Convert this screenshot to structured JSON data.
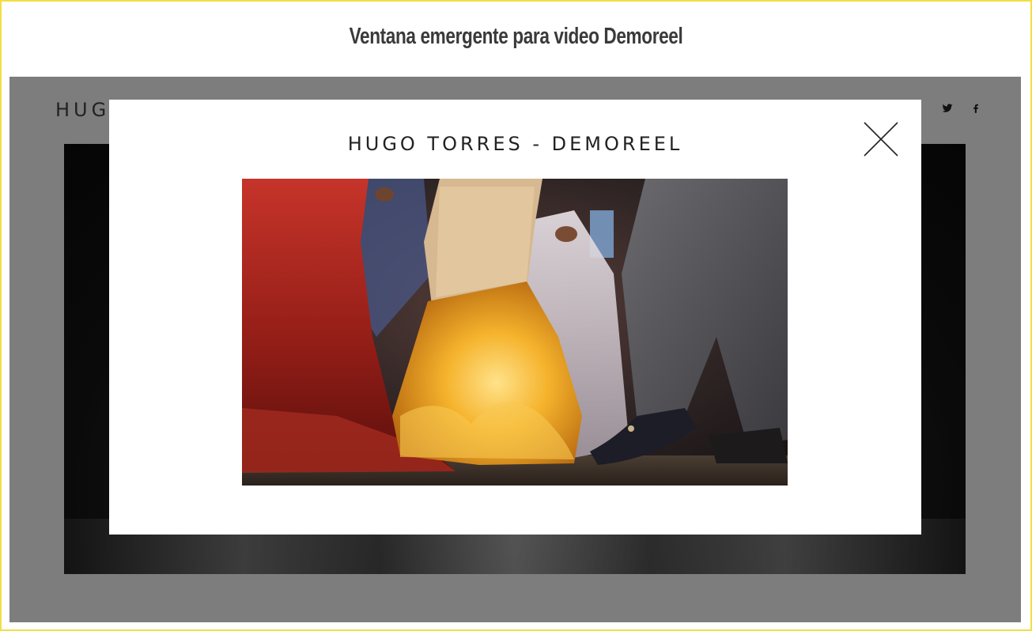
{
  "caption": "Ventana emergente para video Demoreel",
  "site": {
    "brand": "HUGO",
    "social": [
      "twitter-icon",
      "facebook-icon"
    ]
  },
  "modal": {
    "title": "HUGO TORRES - DEMOREEL",
    "close_icon": "close-icon"
  },
  "colors": {
    "frame_border": "#f1df45",
    "overlay": "#7d7d7d",
    "modal_bg": "#ffffff",
    "text": "#222222"
  }
}
